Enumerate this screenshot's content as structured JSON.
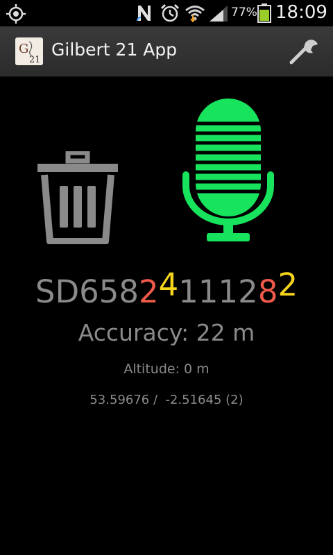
{
  "status_bar": {
    "battery_percent": "77%",
    "time": "18:09",
    "icons": [
      "gps-icon",
      "n-notification-icon",
      "alarm-icon",
      "wifi-icon",
      "signal-icon",
      "battery-icon"
    ],
    "battery_color": "#9acd2a"
  },
  "app_bar": {
    "title": "Gilbert 21 App",
    "settings_icon": "wrench-icon"
  },
  "main": {
    "delete_icon": "trash-icon",
    "record_icon": "microphone-icon",
    "mic_color": "#17e35c",
    "grid_ref": {
      "prefix": "SD658",
      "e_highlight": "2",
      "e_highlight2": "4",
      "e_mid": "1112",
      "n_highlight": "8",
      "n_highlight2": "2"
    },
    "accuracy": "Accuracy: 22 m",
    "altitude": "Altitude: 0 m",
    "coordinates": "53.59676 /  -2.51645 (2)"
  }
}
